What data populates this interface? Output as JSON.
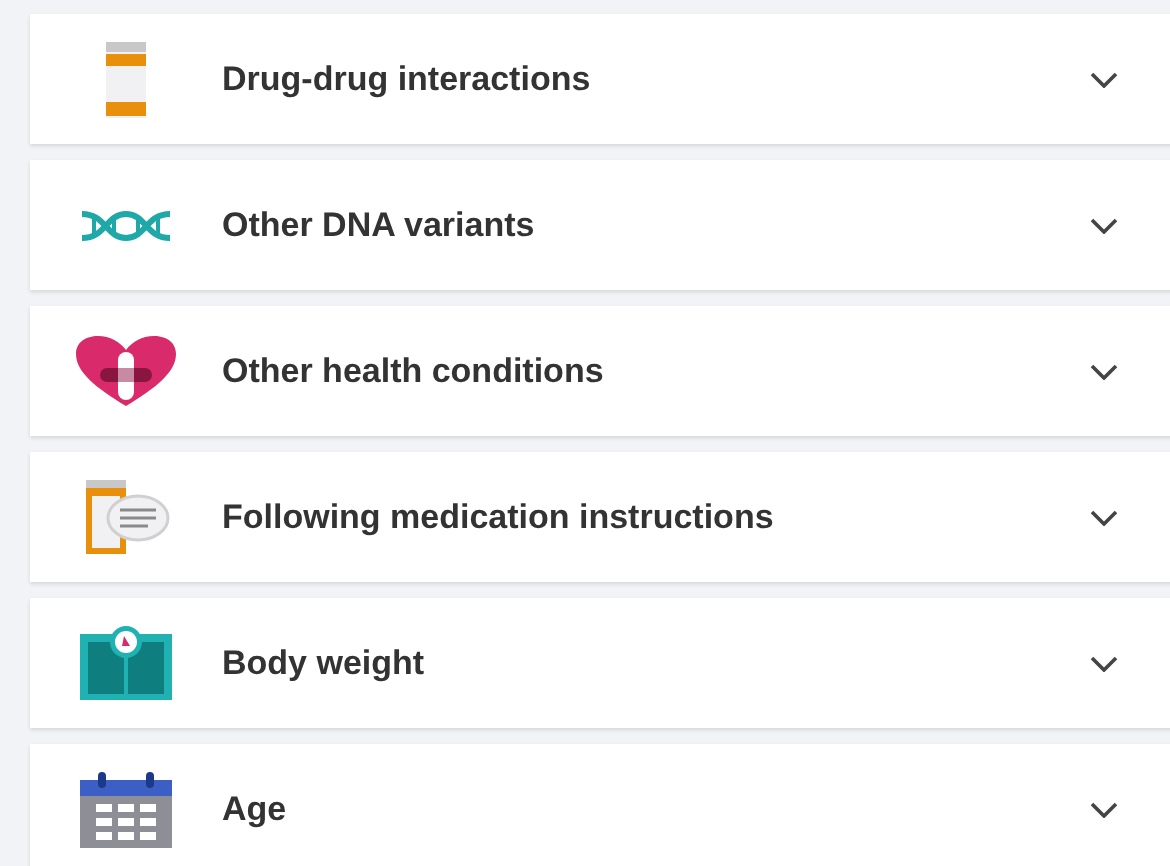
{
  "items": [
    {
      "kind": "pill-bottle",
      "label": "Drug-drug interactions",
      "expanded": false
    },
    {
      "kind": "dna",
      "label": "Other DNA variants",
      "expanded": false
    },
    {
      "kind": "heart",
      "label": "Other health conditions",
      "expanded": false
    },
    {
      "kind": "instructions",
      "label": "Following medication instructions",
      "expanded": false
    },
    {
      "kind": "scale",
      "label": "Body weight",
      "expanded": false
    },
    {
      "kind": "calendar",
      "label": "Age",
      "expanded": false
    }
  ]
}
